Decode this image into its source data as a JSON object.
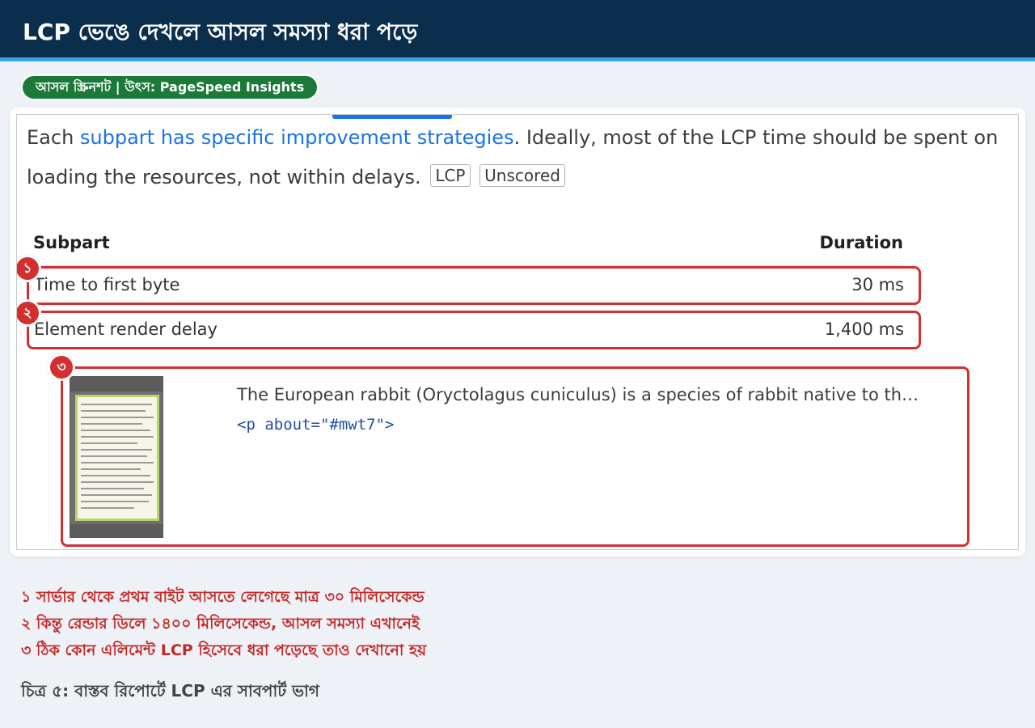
{
  "header": {
    "title": "LCP ভেঙে দেখলে আসল সমস্যা ধরা পড়ে"
  },
  "source_badge": "আসল স্ক্রিনশট | উৎস: PageSpeed Insights",
  "report": {
    "description": {
      "prefix": "Each ",
      "link": "subpart has specific improvement strategies",
      "suffix": ". Ideally, most of the LCP time should be spent on loading the resources, not within delays."
    },
    "chips": [
      "LCP",
      "Unscored"
    ],
    "table": {
      "headers": {
        "subpart": "Subpart",
        "duration": "Duration"
      },
      "rows": [
        {
          "label": "Time to first byte",
          "value": "30 ms"
        },
        {
          "label": "Element render delay",
          "value": "1,400 ms"
        }
      ]
    },
    "element": {
      "snippet": "The European rabbit (Oryctolagus cuniculus) is a species of rabbit native to th…",
      "code": "<p about=\"#mwt7\">"
    },
    "markers": [
      "১",
      "২",
      "৩"
    ]
  },
  "notes": [
    "১ সার্ভার থেকে প্রথম বাইট আসতে লেগেছে মাত্র ৩০ মিলিসেকেন্ড",
    "২ কিন্তু রেন্ডার ডিলে ১৪০০ মিলিসেকেন্ড, আসল সমস্যা এখানেই",
    "৩ ঠিক কোন এলিমেন্ট LCP হিসেবে ধরা পড়েছে তাও দেখানো হয়"
  ],
  "caption": "চিত্র ৫: বাস্তব রিপোর্টে LCP এর সাবপার্ট ভাগ",
  "colors": {
    "header_bg": "#0b2e4d",
    "accent_line": "#3aa6e0",
    "badge_green": "#1b7a3a",
    "highlight_red": "#d32f2f",
    "link_blue": "#1a73e8"
  }
}
